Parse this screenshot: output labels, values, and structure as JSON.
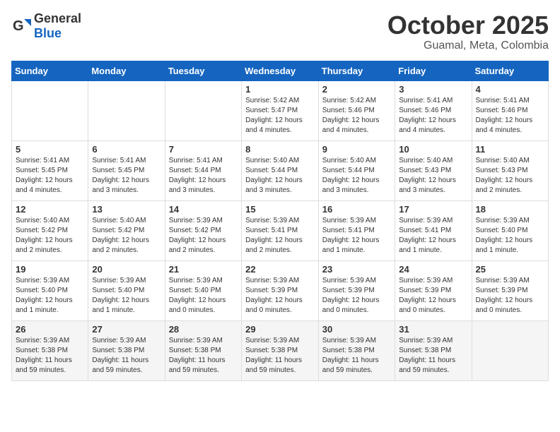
{
  "header": {
    "logo_general": "General",
    "logo_blue": "Blue",
    "month": "October 2025",
    "location": "Guamal, Meta, Colombia"
  },
  "days_of_week": [
    "Sunday",
    "Monday",
    "Tuesday",
    "Wednesday",
    "Thursday",
    "Friday",
    "Saturday"
  ],
  "weeks": [
    [
      {
        "day": "",
        "info": ""
      },
      {
        "day": "",
        "info": ""
      },
      {
        "day": "",
        "info": ""
      },
      {
        "day": "1",
        "info": "Sunrise: 5:42 AM\nSunset: 5:47 PM\nDaylight: 12 hours\nand 4 minutes."
      },
      {
        "day": "2",
        "info": "Sunrise: 5:42 AM\nSunset: 5:46 PM\nDaylight: 12 hours\nand 4 minutes."
      },
      {
        "day": "3",
        "info": "Sunrise: 5:41 AM\nSunset: 5:46 PM\nDaylight: 12 hours\nand 4 minutes."
      },
      {
        "day": "4",
        "info": "Sunrise: 5:41 AM\nSunset: 5:46 PM\nDaylight: 12 hours\nand 4 minutes."
      }
    ],
    [
      {
        "day": "5",
        "info": "Sunrise: 5:41 AM\nSunset: 5:45 PM\nDaylight: 12 hours\nand 4 minutes."
      },
      {
        "day": "6",
        "info": "Sunrise: 5:41 AM\nSunset: 5:45 PM\nDaylight: 12 hours\nand 3 minutes."
      },
      {
        "day": "7",
        "info": "Sunrise: 5:41 AM\nSunset: 5:44 PM\nDaylight: 12 hours\nand 3 minutes."
      },
      {
        "day": "8",
        "info": "Sunrise: 5:40 AM\nSunset: 5:44 PM\nDaylight: 12 hours\nand 3 minutes."
      },
      {
        "day": "9",
        "info": "Sunrise: 5:40 AM\nSunset: 5:44 PM\nDaylight: 12 hours\nand 3 minutes."
      },
      {
        "day": "10",
        "info": "Sunrise: 5:40 AM\nSunset: 5:43 PM\nDaylight: 12 hours\nand 3 minutes."
      },
      {
        "day": "11",
        "info": "Sunrise: 5:40 AM\nSunset: 5:43 PM\nDaylight: 12 hours\nand 2 minutes."
      }
    ],
    [
      {
        "day": "12",
        "info": "Sunrise: 5:40 AM\nSunset: 5:42 PM\nDaylight: 12 hours\nand 2 minutes."
      },
      {
        "day": "13",
        "info": "Sunrise: 5:40 AM\nSunset: 5:42 PM\nDaylight: 12 hours\nand 2 minutes."
      },
      {
        "day": "14",
        "info": "Sunrise: 5:39 AM\nSunset: 5:42 PM\nDaylight: 12 hours\nand 2 minutes."
      },
      {
        "day": "15",
        "info": "Sunrise: 5:39 AM\nSunset: 5:41 PM\nDaylight: 12 hours\nand 2 minutes."
      },
      {
        "day": "16",
        "info": "Sunrise: 5:39 AM\nSunset: 5:41 PM\nDaylight: 12 hours\nand 1 minute."
      },
      {
        "day": "17",
        "info": "Sunrise: 5:39 AM\nSunset: 5:41 PM\nDaylight: 12 hours\nand 1 minute."
      },
      {
        "day": "18",
        "info": "Sunrise: 5:39 AM\nSunset: 5:40 PM\nDaylight: 12 hours\nand 1 minute."
      }
    ],
    [
      {
        "day": "19",
        "info": "Sunrise: 5:39 AM\nSunset: 5:40 PM\nDaylight: 12 hours\nand 1 minute."
      },
      {
        "day": "20",
        "info": "Sunrise: 5:39 AM\nSunset: 5:40 PM\nDaylight: 12 hours\nand 1 minute."
      },
      {
        "day": "21",
        "info": "Sunrise: 5:39 AM\nSunset: 5:40 PM\nDaylight: 12 hours\nand 0 minutes."
      },
      {
        "day": "22",
        "info": "Sunrise: 5:39 AM\nSunset: 5:39 PM\nDaylight: 12 hours\nand 0 minutes."
      },
      {
        "day": "23",
        "info": "Sunrise: 5:39 AM\nSunset: 5:39 PM\nDaylight: 12 hours\nand 0 minutes."
      },
      {
        "day": "24",
        "info": "Sunrise: 5:39 AM\nSunset: 5:39 PM\nDaylight: 12 hours\nand 0 minutes."
      },
      {
        "day": "25",
        "info": "Sunrise: 5:39 AM\nSunset: 5:39 PM\nDaylight: 12 hours\nand 0 minutes."
      }
    ],
    [
      {
        "day": "26",
        "info": "Sunrise: 5:39 AM\nSunset: 5:38 PM\nDaylight: 11 hours\nand 59 minutes."
      },
      {
        "day": "27",
        "info": "Sunrise: 5:39 AM\nSunset: 5:38 PM\nDaylight: 11 hours\nand 59 minutes."
      },
      {
        "day": "28",
        "info": "Sunrise: 5:39 AM\nSunset: 5:38 PM\nDaylight: 11 hours\nand 59 minutes."
      },
      {
        "day": "29",
        "info": "Sunrise: 5:39 AM\nSunset: 5:38 PM\nDaylight: 11 hours\nand 59 minutes."
      },
      {
        "day": "30",
        "info": "Sunrise: 5:39 AM\nSunset: 5:38 PM\nDaylight: 11 hours\nand 59 minutes."
      },
      {
        "day": "31",
        "info": "Sunrise: 5:39 AM\nSunset: 5:38 PM\nDaylight: 11 hours\nand 59 minutes."
      },
      {
        "day": "",
        "info": ""
      }
    ]
  ]
}
